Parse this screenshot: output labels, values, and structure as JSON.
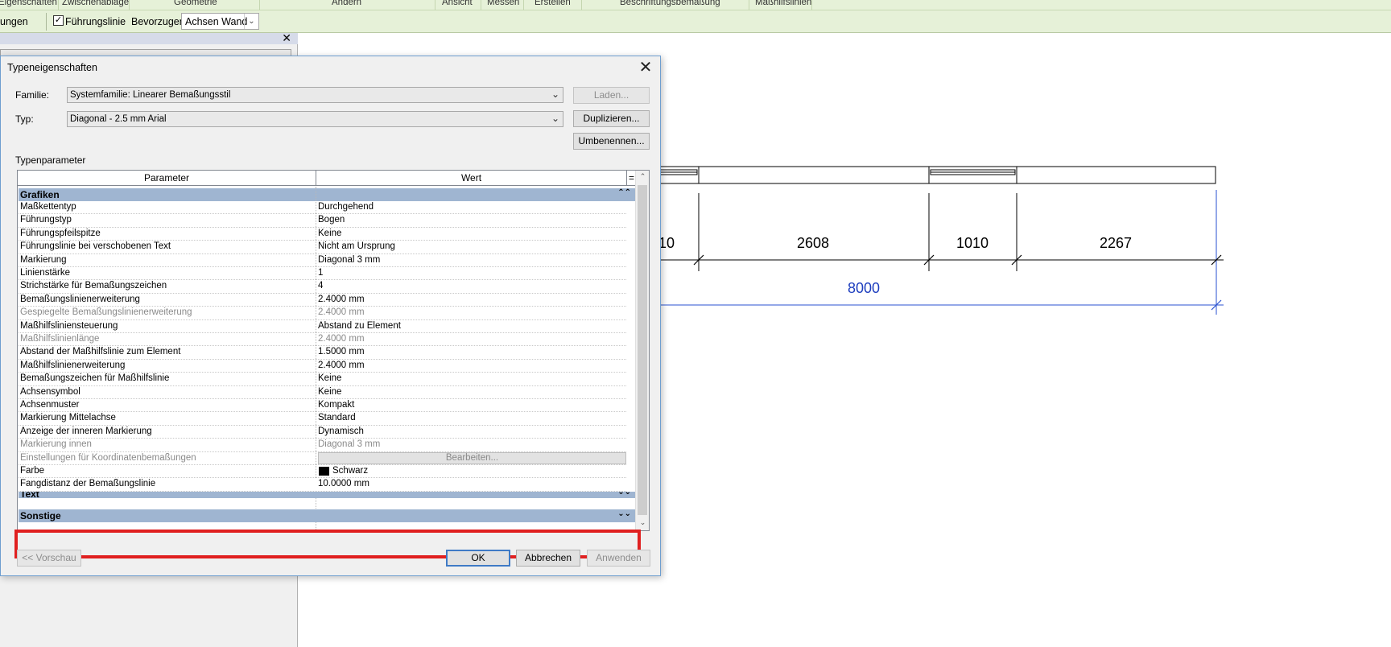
{
  "ribbon": {
    "panels": [
      "Eigenschaften",
      "Zwischenablage",
      "Geometrie",
      "Ändern",
      "Ansicht",
      "Messen",
      "Erstellen",
      "Beschriftungsbemaßung",
      "Maßhilfslinien"
    ]
  },
  "options_bar": {
    "left_label": "ungen",
    "leader_label": "Führungslinie",
    "leader_checked": "✓",
    "prefer_label": "Bevorzugen:",
    "prefer_value": "Achsen Wand"
  },
  "left_panel": {
    "close": "✕"
  },
  "dialog": {
    "title": "Typeneigenschaften",
    "close": "✕",
    "family_label": "Familie:",
    "family_value": "Systemfamilie: Linearer Bemaßungsstil",
    "type_label": "Typ:",
    "type_value": "Diagonal - 2.5 mm Arial",
    "load_button": "Laden...",
    "duplicate_button": "Duplizieren...",
    "rename_button": "Umbenennen...",
    "type_params_label": "Typenparameter",
    "col_param": "Parameter",
    "col_value": "Wert",
    "col_sort": "=",
    "section_graphics": "Grafiken",
    "section_text": "Text",
    "section_other": "Sonstige",
    "rows": [
      {
        "p": "Maßkettentyp",
        "w": "Durchgehend"
      },
      {
        "p": "Führungstyp",
        "w": "Bogen"
      },
      {
        "p": "Führungspfeilspitze",
        "w": "Keine"
      },
      {
        "p": "Führungslinie bei verschobenen Text",
        "w": "Nicht am Ursprung"
      },
      {
        "p": "Markierung",
        "w": "Diagonal 3 mm"
      },
      {
        "p": "Linienstärke",
        "w": "1"
      },
      {
        "p": "Strichstärke für Bemaßungszeichen",
        "w": "4"
      },
      {
        "p": "Bemaßungslinienerweiterung",
        "w": "2.4000 mm"
      },
      {
        "p": "Gespiegelte Bemaßungslinienerweiterung",
        "w": "2.4000 mm"
      },
      {
        "p": "Maßhilfsliniensteuerung",
        "w": "Abstand zu Element"
      },
      {
        "p": "Maßhilfslinienlänge",
        "w": "2.4000 mm"
      },
      {
        "p": "Abstand der Maßhilfslinie zum Element",
        "w": "1.5000 mm"
      },
      {
        "p": "Maßhilfslinienerweiterung",
        "w": "2.4000 mm"
      },
      {
        "p": "Bemaßungszeichen für Maßhilfslinie",
        "w": "Keine"
      },
      {
        "p": "Achsensymbol",
        "w": "Keine"
      },
      {
        "p": "Achsenmuster",
        "w": "Kompakt"
      },
      {
        "p": "Markierung Mittelachse",
        "w": "Standard"
      },
      {
        "p": "Anzeige der inneren Markierung",
        "w": "Dynamisch"
      },
      {
        "p": "Markierung innen",
        "w": "Diagonal 3 mm"
      },
      {
        "p": "Einstellungen für Koordinatenbemaßungen",
        "w": "Bearbeiten..."
      },
      {
        "p": "Farbe",
        "w": "Schwarz"
      },
      {
        "p": "Fangdistanz der Bemaßungslinie",
        "w": "10.0000 mm"
      }
    ],
    "preview_button": "<< Vorschau",
    "ok_button": "OK",
    "cancel_button": "Abbrechen",
    "apply_button": "Anwenden"
  },
  "drawing": {
    "dims": [
      "10",
      "2608",
      "1010",
      "2267"
    ],
    "total": "8000",
    "total_color": "#1f3fbf",
    "line_color": "#2a52d0"
  }
}
